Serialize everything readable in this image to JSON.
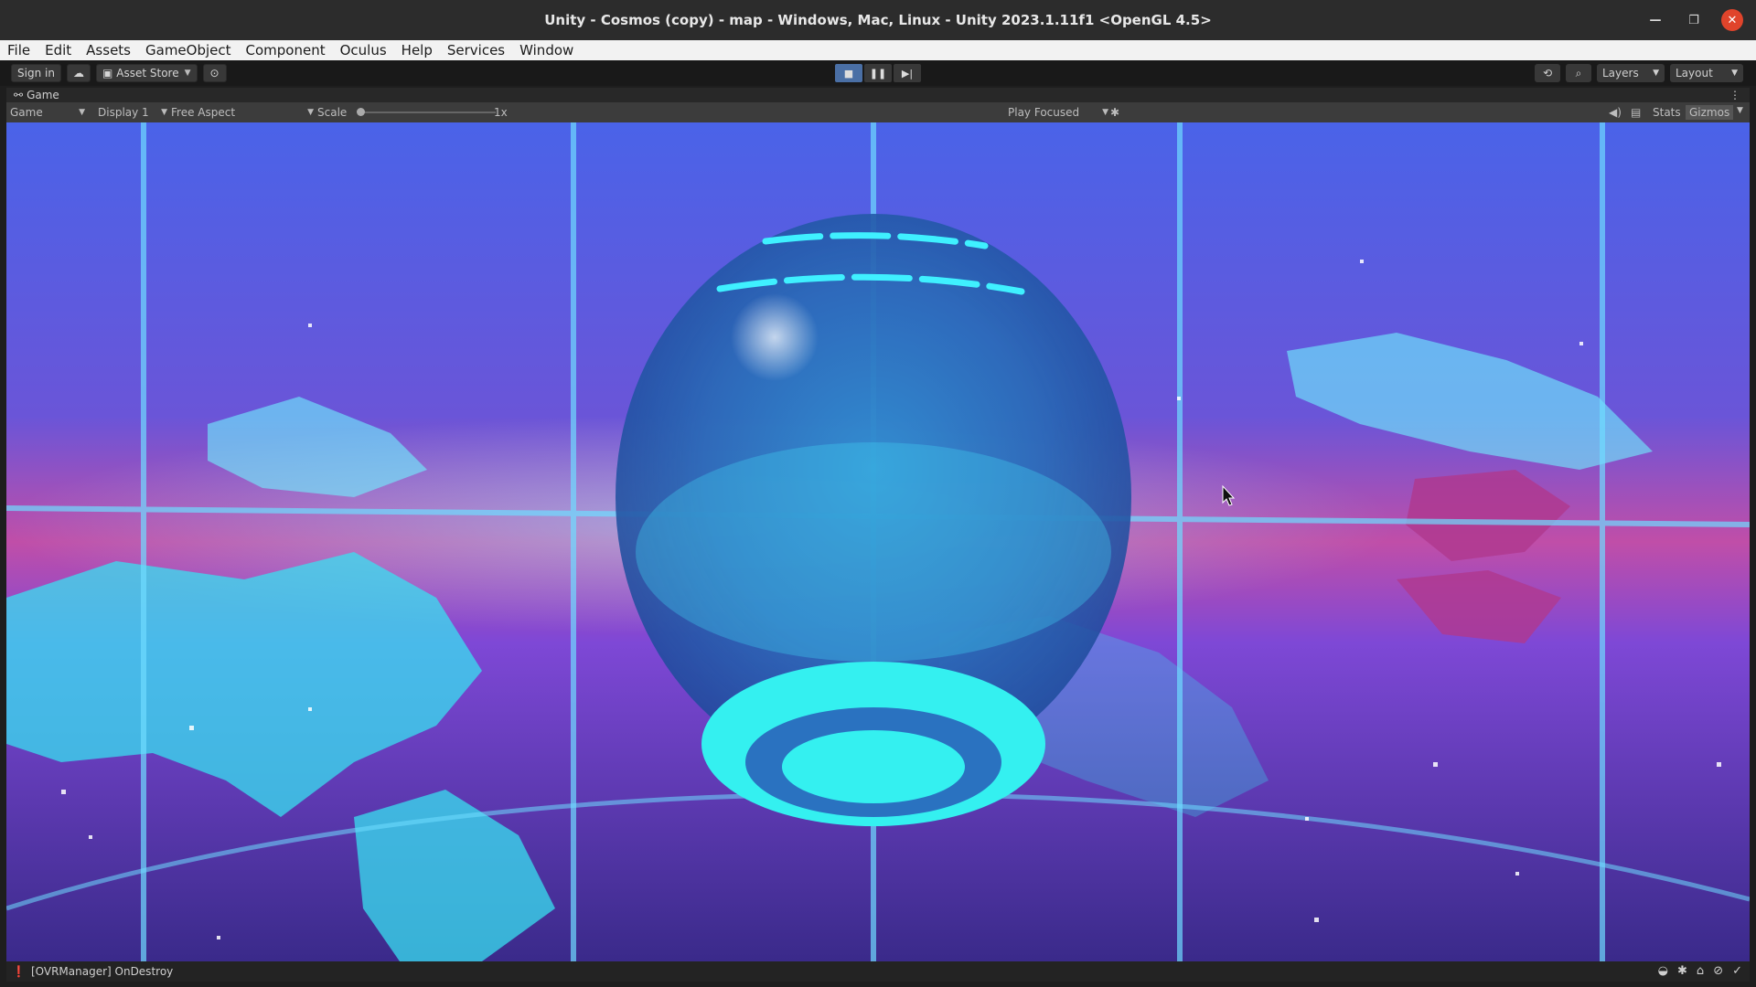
{
  "window": {
    "title": "Unity - Cosmos (copy) - map - Windows, Mac, Linux - Unity 2023.1.11f1 <OpenGL 4.5>",
    "minimize_icon": "minimize-icon",
    "maximize_icon": "restore-icon",
    "close_icon": "close-icon"
  },
  "menu": [
    "File",
    "Edit",
    "Assets",
    "GameObject",
    "Component",
    "Oculus",
    "Help",
    "Services",
    "Window"
  ],
  "toolbar": {
    "sign_in": "Sign in",
    "asset_store": "Asset Store",
    "play_buttons": [
      "stop-icon",
      "pause-icon",
      "step-icon"
    ],
    "layers": "Layers",
    "layout": "Layout"
  },
  "game_tab": {
    "label": "Game"
  },
  "game_toolbar": {
    "mode": "Game",
    "display": "Display 1",
    "aspect": "Free Aspect",
    "scale_label": "Scale",
    "scale_value": "1x",
    "play_focused": "Play Focused",
    "stats": "Stats",
    "gizmos": "Gizmos"
  },
  "status": {
    "message": "[OVRManager] OnDestroy"
  },
  "colors": {
    "cyan_glow": "#2ff0f0",
    "purple": "#8a3fd0",
    "blue": "#3a5fe0",
    "pink": "#c3479a"
  }
}
